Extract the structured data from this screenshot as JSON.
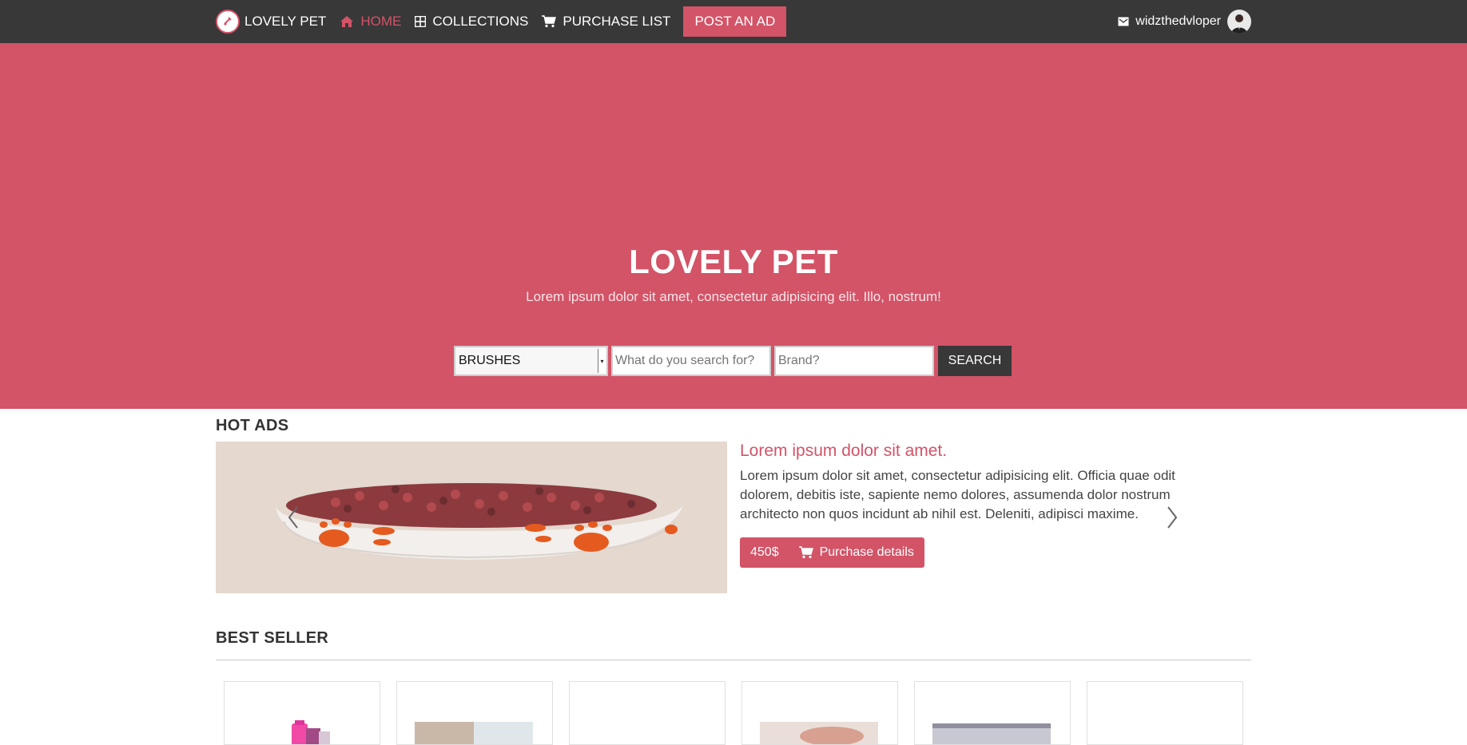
{
  "nav": {
    "brand": "LOVELY PET",
    "items": [
      {
        "label": "HOME",
        "icon": "home-icon",
        "active": true
      },
      {
        "label": "COLLECTIONS",
        "icon": "grid-icon",
        "active": false
      },
      {
        "label": "PURCHASE LIST",
        "icon": "cart-icon",
        "active": false
      }
    ],
    "post_ad": "POST AN AD",
    "username": "widzthedvloper"
  },
  "hero": {
    "title": "LOVELY PET",
    "subtitle": "Lorem ipsum dolor sit amet, consectetur adipisicing elit. Illo, nostrum!",
    "search": {
      "category_selected": "BRUSHES",
      "query_placeholder": "What do you search for?",
      "brand_placeholder": "Brand?",
      "button": "SEARCH"
    }
  },
  "hot_ads": {
    "heading": "HOT ADS",
    "ad": {
      "title": "Lorem ipsum dolor sit amet.",
      "body": "Lorem ipsum dolor sit amet, consectetur adipisicing elit. Officia quae odit dolorem, debitis iste, sapiente nemo dolores, assumenda dolor nostrum architecto non quos incidunt ab nihil est. Deleniti, adipisci maxime.",
      "price": "450$",
      "purchase_label": "Purchase details"
    }
  },
  "best_seller": {
    "heading": "BEST SELLER",
    "card_count_note": ""
  },
  "colors": {
    "accent": "#d35367",
    "navbar": "#383838"
  }
}
